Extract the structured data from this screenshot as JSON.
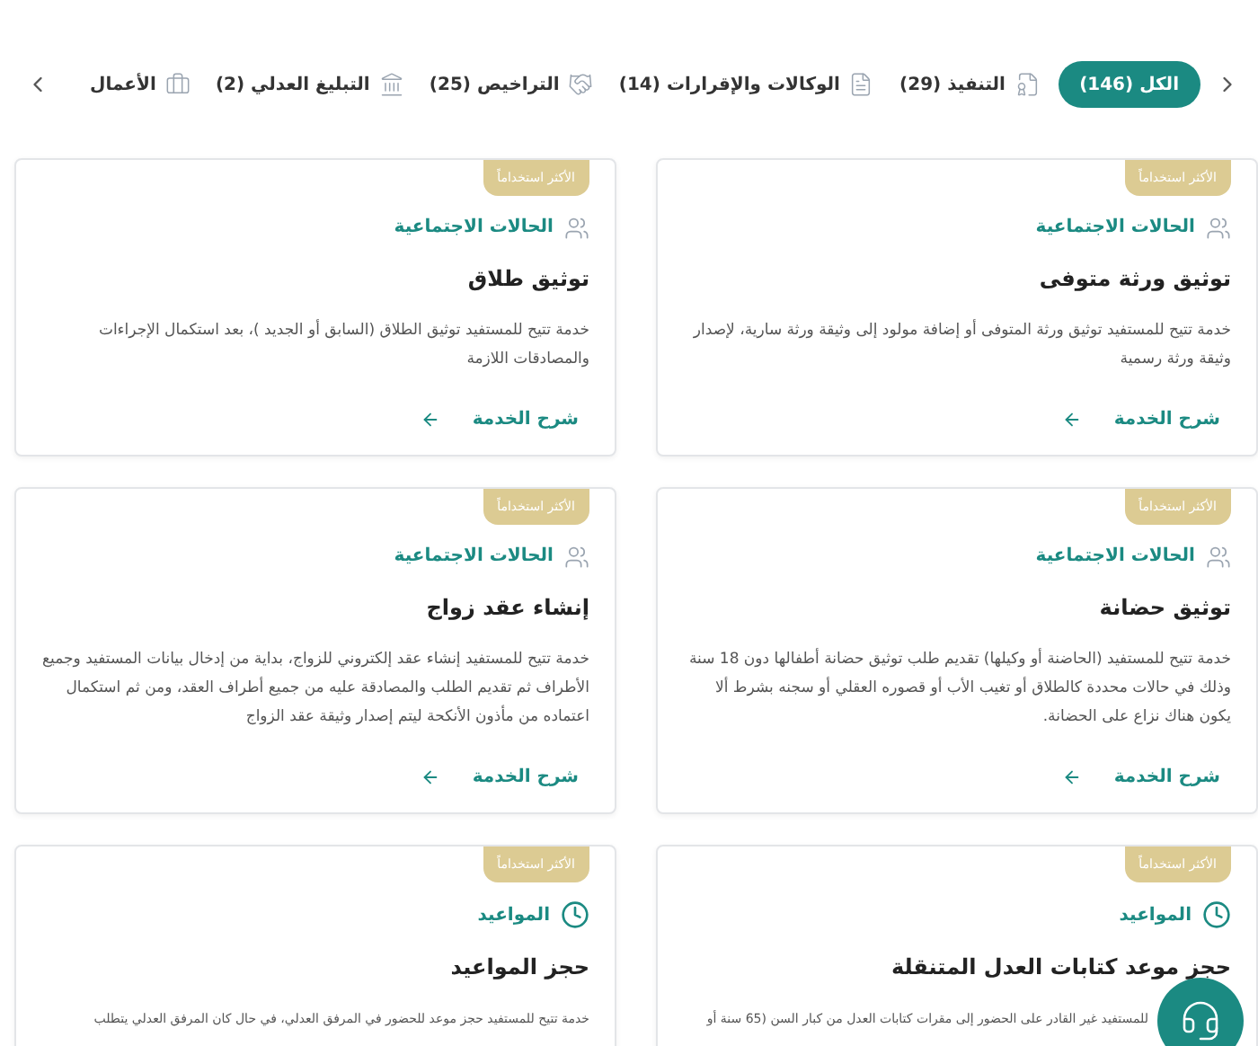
{
  "tabs": [
    {
      "label": "الكل (146)",
      "kind": "all",
      "selected": true
    },
    {
      "label": "التنفيذ (29)",
      "kind": "execution",
      "selected": false
    },
    {
      "label": "الوكالات والإقرارات (14)",
      "kind": "documents",
      "selected": false
    },
    {
      "label": "التراخيص (25)",
      "kind": "licenses",
      "selected": false
    },
    {
      "label": "التبليغ العدلي (2)",
      "kind": "notification",
      "selected": false
    },
    {
      "label": "الأعمال",
      "kind": "business",
      "selected": false
    }
  ],
  "cards": [
    {
      "badge": "الأكثر استخداماً",
      "category": {
        "label": "الحالات الاجتماعية",
        "kind": "social"
      },
      "title": "توثيق ورثة متوفى",
      "description": "خدمة تتيح للمستفيد توثيق ورثة المتوفى أو إضافة مولود إلى وثيقة ورثة سارية، لإصدار وثيقة ورثة رسمية",
      "link": "شرح الخدمة"
    },
    {
      "badge": "الأكثر استخداماً",
      "category": {
        "label": "الحالات الاجتماعية",
        "kind": "social"
      },
      "title": "توثيق طلاق",
      "description": "خدمة تتيح للمستفيد توثيق الطلاق (السابق أو الجديد )، بعد استكمال الإجراءات والمصادقات اللازمة",
      "link": "شرح الخدمة"
    },
    {
      "badge": "الأكثر استخداماً",
      "category": {
        "label": "الحالات الاجتماعية",
        "kind": "social"
      },
      "title": "توثيق حضانة",
      "description": "خدمة تتيح للمستفيد (الحاضنة أو وكيلها) تقديم طلب توثيق حضانة أطفالها دون 18 سنة وذلك في حالات محددة كالطلاق أو تغيب الأب أو قصوره العقلي أو سجنه بشرط ألا يكون هناك نزاع على الحضانة.",
      "link": "شرح الخدمة"
    },
    {
      "badge": "الأكثر استخداماً",
      "category": {
        "label": "الحالات الاجتماعية",
        "kind": "social"
      },
      "title": "إنشاء عقد زواج",
      "description": "خدمة تتيح للمستفيد إنشاء عقد إلكتروني للزواج، بداية من إدخال بيانات المستفيد وجميع الأطراف ثم تقديم الطلب والمصادقة عليه من جميع أطراف العقد، ومن ثم استكمال اعتماده من مأذون الأنكحة ليتم إصدار وثيقة عقد الزواج",
      "link": "شرح الخدمة"
    },
    {
      "badge": "الأكثر استخداماً",
      "category": {
        "label": "المواعيد",
        "kind": "appointments"
      },
      "title": "حجز موعد كتابات العدل المتنقلة",
      "description": "للمستفيد غير القادر على الحضور إلى مقرات كتابات العدل من كبار السن (65 سنة أو"
    },
    {
      "badge": "الأكثر استخداماً",
      "category": {
        "label": "المواعيد",
        "kind": "appointments"
      },
      "title": "حجز المواعيد",
      "description": "خدمة تتيح للمستفيد حجز موعد للحضور في المرفق العدلي، في حال كان المرفق العدلي يتطلب"
    }
  ]
}
